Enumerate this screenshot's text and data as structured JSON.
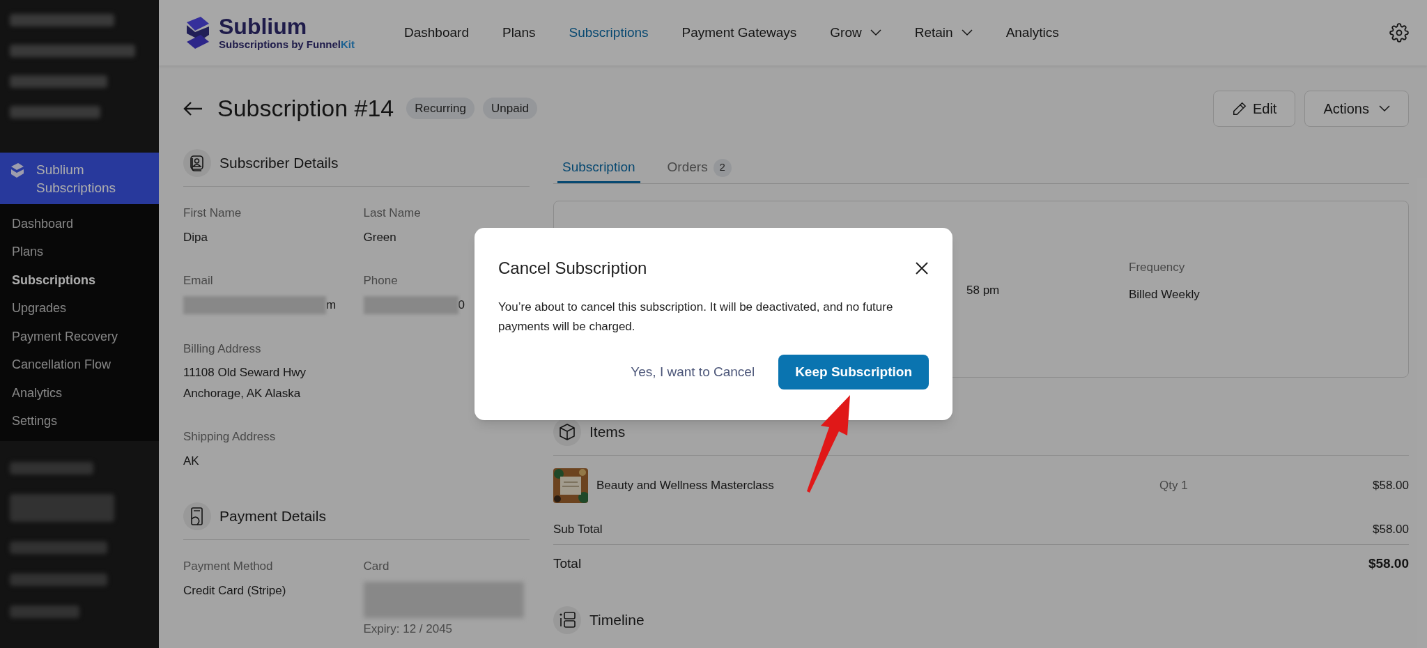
{
  "sidebar": {
    "header": "Sublium Subscriptions",
    "items": [
      {
        "label": "Dashboard",
        "selected": false
      },
      {
        "label": "Plans",
        "selected": false
      },
      {
        "label": "Subscriptions",
        "selected": true
      },
      {
        "label": "Upgrades",
        "selected": false
      },
      {
        "label": "Payment Recovery",
        "selected": false
      },
      {
        "label": "Cancellation Flow",
        "selected": false
      },
      {
        "label": "Analytics",
        "selected": false
      },
      {
        "label": "Settings",
        "selected": false
      }
    ]
  },
  "top_nav": {
    "logo_title": "Sublium",
    "logo_subtitle": {
      "text": "Subscriptions by Funnel",
      "accent": "Kit"
    },
    "items": [
      {
        "label": "Dashboard",
        "selected": false,
        "dropdown": false
      },
      {
        "label": "Plans",
        "selected": false,
        "dropdown": false
      },
      {
        "label": "Subscriptions",
        "selected": true,
        "dropdown": false
      },
      {
        "label": "Payment Gateways",
        "selected": false,
        "dropdown": false
      },
      {
        "label": "Grow",
        "selected": false,
        "dropdown": true
      },
      {
        "label": "Retain",
        "selected": false,
        "dropdown": true
      },
      {
        "label": "Analytics",
        "selected": false,
        "dropdown": false
      }
    ]
  },
  "page": {
    "title": "Subscription #14",
    "badges": [
      "Recurring",
      "Unpaid"
    ],
    "edit_button": "Edit",
    "actions_button": "Actions"
  },
  "subscriber_details": {
    "title": "Subscriber Details",
    "fields": [
      {
        "label": "First Name",
        "value": "Dipa",
        "kind": "text"
      },
      {
        "label": "Last Name",
        "value": "Green",
        "kind": "text"
      },
      {
        "label": "Email",
        "value": "m",
        "kind": "redacted"
      },
      {
        "label": "Phone",
        "value": "0",
        "kind": "redacted"
      },
      {
        "label": "Billing Address",
        "lines": [
          "11108 Old Seward Hwy",
          "Anchorage, AK Alaska"
        ],
        "kind": "multiline"
      },
      {
        "label": "Shipping Address",
        "value": "AK",
        "kind": "text"
      }
    ]
  },
  "payment_details": {
    "title": "Payment Details",
    "fields": [
      {
        "label": "Payment Method",
        "value": "Credit Card (Stripe)",
        "kind": "text"
      },
      {
        "label": "Card",
        "value": "Expiry: 12 / 2045",
        "kind": "redacted_block"
      }
    ]
  },
  "tabs": [
    {
      "label": "Subscription",
      "selected": true
    },
    {
      "label": "Orders",
      "selected": false,
      "count": "2"
    }
  ],
  "plan_card": {
    "fields": [
      {
        "value": "58 pm"
      },
      {
        "label": "Frequency",
        "value": "Billed Weekly"
      }
    ]
  },
  "items": {
    "title": "Items",
    "rows": [
      {
        "name": "Beauty and Wellness Masterclass",
        "qty": "Qty 1",
        "price": "$58.00"
      }
    ],
    "subtotal": {
      "label": "Sub Total",
      "value": "$58.00"
    },
    "total": {
      "label": "Total",
      "value": "$58.00"
    }
  },
  "timeline": {
    "title": "Timeline"
  },
  "dialog": {
    "title": "Cancel Subscription",
    "message": "You’re about to cancel this subscription. It will be deactivated, and no future payments will be charged.",
    "secondary_button": "Yes, I want to Cancel",
    "primary_button": "Keep Subscription"
  }
}
